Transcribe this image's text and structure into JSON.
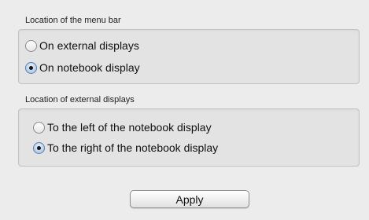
{
  "menu_bar_group": {
    "title": "Location of the menu bar",
    "options": [
      {
        "label": "On external displays",
        "checked": false
      },
      {
        "label": "On notebook display",
        "checked": true
      }
    ]
  },
  "external_displays_group": {
    "title": "Location of external displays",
    "options": [
      {
        "label": "To the left of the notebook display",
        "checked": false
      },
      {
        "label": "To the right of the notebook display",
        "checked": true
      }
    ]
  },
  "apply_button": {
    "label": "Apply"
  }
}
